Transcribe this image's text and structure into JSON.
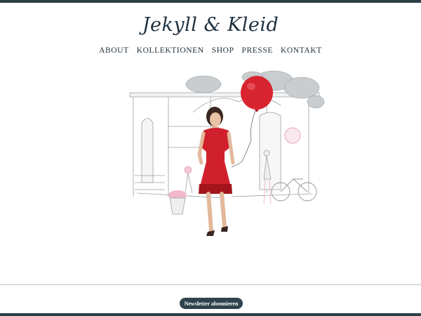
{
  "brand": {
    "logo_text": "Jekyll & Kleid"
  },
  "nav": {
    "items": [
      {
        "label": "ABOUT"
      },
      {
        "label": "KOLLEKTIONEN"
      },
      {
        "label": "SHOP"
      },
      {
        "label": "PRESSE"
      },
      {
        "label": "KONTAKT"
      }
    ]
  },
  "hero": {
    "image_icon": "woman-red-dress-balloon-illustration"
  },
  "footer": {
    "newsletter_label": "Newsletter abonnieren"
  },
  "colors": {
    "dark_teal": "#2c3e46",
    "dress_red": "#d0202b",
    "balloon_red": "#d8242f",
    "sketch_gray": "#9aa0a4",
    "sketch_pink": "#e9a6c0"
  }
}
